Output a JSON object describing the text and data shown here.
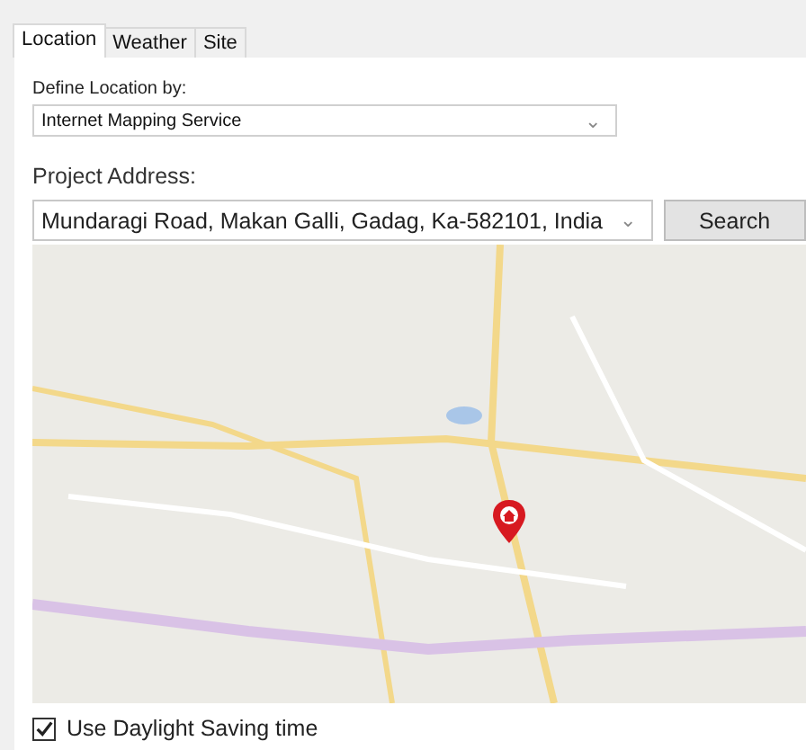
{
  "tabs": [
    {
      "label": "Location",
      "selected": true
    },
    {
      "label": "Weather",
      "selected": false
    },
    {
      "label": "Site",
      "selected": false
    }
  ],
  "location_method": {
    "label": "Define Location by:",
    "value": "Internet Mapping Service",
    "caret": "⌄"
  },
  "project_address": {
    "label": "Project Address:",
    "value": "Mundaragi Road, Makan Galli, Gadag, Ka-582101, India",
    "caret": "⌄"
  },
  "search_button": "Search",
  "daylight_saving": {
    "label": "Use Daylight Saving time",
    "checked": true
  }
}
